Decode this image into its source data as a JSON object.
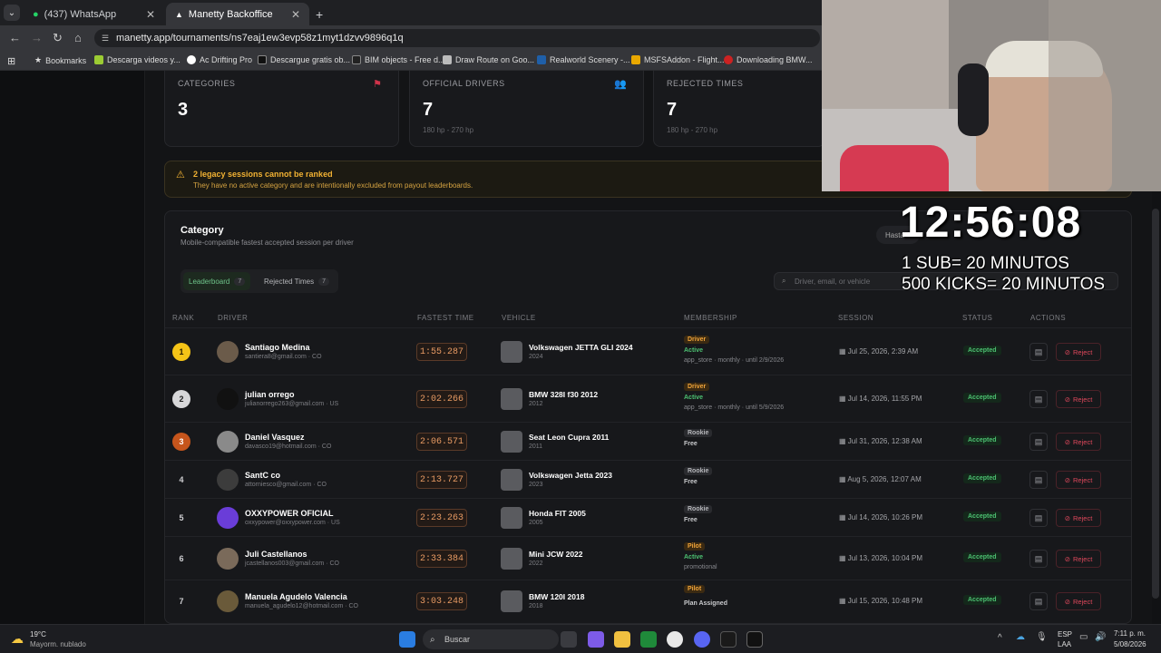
{
  "browser": {
    "tabs": [
      {
        "label": "(437) WhatsApp"
      },
      {
        "label": "Manetty Backoffice"
      }
    ],
    "url": "manetty.app/tournaments/ns7eaj1ew3evp58z1myt1dzvv9896q1q",
    "bookmarks": [
      {
        "label": "Bookmarks",
        "color": "#dddddd"
      },
      {
        "label": "Descarga videos y...",
        "color": "#9ccc33"
      },
      {
        "label": "Ac Drifting Pro",
        "color": "#ffffff"
      },
      {
        "label": "Descargue gratis ob...",
        "color": "#111111"
      },
      {
        "label": "BIM objects - Free d...",
        "color": "#222222"
      },
      {
        "label": "Draw Route on Goo...",
        "color": "#bbbbbb"
      },
      {
        "label": "Realworld Scenery -...",
        "color": "#1f5fa8"
      },
      {
        "label": "MSFSAddon - Flight...",
        "color": "#e9a800"
      },
      {
        "label": "Downloading BMW...",
        "color": "#cc2222"
      }
    ]
  },
  "stats": [
    {
      "label": "CATEGORIES",
      "value": "3",
      "sub": "",
      "icon": "flag-icon"
    },
    {
      "label": "OFFICIAL DRIVERS",
      "value": "7",
      "sub": "180 hp - 270 hp",
      "icon": "users-icon"
    },
    {
      "label": "REJECTED TIMES",
      "value": "7",
      "sub": "180 hp - 270 hp",
      "icon": "x-icon"
    }
  ],
  "warning": {
    "title": "2 legacy sessions cannot be ranked",
    "text": "They have no active category and are intentionally excluded from payout leaderboards."
  },
  "panel": {
    "title": "Category",
    "subtitle": "Mobile-compatible fastest accepted session per driver",
    "filter_pill": "Hasta 1",
    "tabs": [
      {
        "label": "Leaderboard",
        "count": "7"
      },
      {
        "label": "Rejected Times",
        "count": "7"
      }
    ],
    "search_placeholder": "Driver, email, or vehicle",
    "headers": [
      "RANK",
      "DRIVER",
      "FASTEST TIME",
      "VEHICLE",
      "MEMBERSHIP",
      "SESSION",
      "STATUS",
      "ACTIONS"
    ]
  },
  "rows": [
    {
      "rank": "1",
      "name": "Santiago Medina",
      "email": "santiera8@gmail.com · CO",
      "time": "1:55.287",
      "vehicle": "Volkswagen JETTA GLI 2024",
      "year": "2024",
      "tier": "Driver",
      "mstatus": "Active",
      "mnote": "app_store · monthly · until 2/9/2026",
      "session": "Jul 25, 2026, 2:39 AM",
      "status": "Accepted",
      "reject": "Reject"
    },
    {
      "rank": "2",
      "name": "julian orrego",
      "email": "julianorrego263@gmail.com · US",
      "time": "2:02.266",
      "vehicle": "BMW 328I f30 2012",
      "year": "2012",
      "tier": "Driver",
      "mstatus": "Active",
      "mnote": "app_store · monthly · until 5/9/2026",
      "session": "Jul 14, 2026, 11:55 PM",
      "status": "Accepted",
      "reject": "Reject"
    },
    {
      "rank": "3",
      "name": "Daniel Vasquez",
      "email": "davasco19@hotmail.com · CO",
      "time": "2:06.571",
      "vehicle": "Seat Leon Cupra 2011",
      "year": "2011",
      "tier": "Rookie",
      "mstatus": "Free",
      "mnote": "",
      "session": "Jul 31, 2026, 12:38 AM",
      "status": "Accepted",
      "reject": "Reject"
    },
    {
      "rank": "4",
      "name": "SantC co",
      "email": "attorniesco@gmail.com · CO",
      "time": "2:13.727",
      "vehicle": "Volkswagen Jetta 2023",
      "year": "2023",
      "tier": "Rookie",
      "mstatus": "Free",
      "mnote": "",
      "session": "Aug 5, 2026, 12:07 AM",
      "status": "Accepted",
      "reject": "Reject"
    },
    {
      "rank": "5",
      "name": "OXXYPOWER OFICIAL",
      "email": "oxxypower@oxxypower.com · US",
      "time": "2:23.263",
      "vehicle": "Honda FIT 2005",
      "year": "2005",
      "tier": "Rookie",
      "mstatus": "Free",
      "mnote": "",
      "session": "Jul 14, 2026, 10:26 PM",
      "status": "Accepted",
      "reject": "Reject"
    },
    {
      "rank": "6",
      "name": "Juli Castellanos",
      "email": "jcastellanos003@gmail.com · CO",
      "time": "2:33.384",
      "vehicle": "Mini JCW 2022",
      "year": "2022",
      "tier": "Pilot",
      "mstatus": "Active",
      "mnote": "promotional",
      "session": "Jul 13, 2026, 10:04 PM",
      "status": "Accepted",
      "reject": "Reject"
    },
    {
      "rank": "7",
      "name": "Manuela Agudelo Valencia",
      "email": "manuela_agudelo12@hotmail.com · CO",
      "time": "3:03.248",
      "vehicle": "BMW 120I 2018",
      "year": "2018",
      "tier": "Pilot",
      "mstatus": "Plan Assigned",
      "mnote": "",
      "session": "Jul 15, 2026, 10:48 PM",
      "status": "Accepted",
      "reject": "Reject"
    }
  ],
  "stream_overlay": {
    "clock": "12:56:08",
    "line1": "1 SUB= 20 MINUTOS",
    "line2": "500 KICKS= 20 MINUTOS"
  },
  "taskbar": {
    "temp": "19°C",
    "weather": "Mayorm. nublado",
    "search": "Buscar",
    "lang1": "ESP",
    "lang2": "LAA",
    "time": "7:11 p. m.",
    "date": "5/08/2026"
  },
  "colors": {
    "accent_green": "#4cc071",
    "time_orange": "#e79a63",
    "warn_yellow": "#f2b233",
    "reject_red": "#e0485c"
  }
}
